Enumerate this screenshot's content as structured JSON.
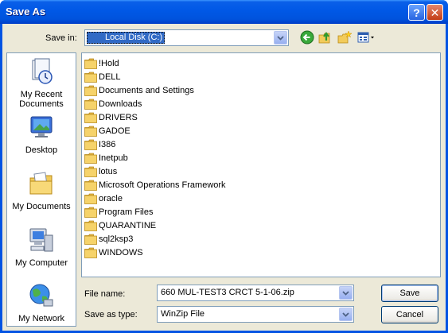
{
  "window": {
    "title": "Save As"
  },
  "toolbar": {
    "save_in_label": "Save in:",
    "save_in_value": "Local Disk (C:)"
  },
  "places": [
    {
      "label": "My Recent\nDocuments",
      "icon": "recent-documents-icon"
    },
    {
      "label": "Desktop",
      "icon": "desktop-icon"
    },
    {
      "label": "My Documents",
      "icon": "my-documents-icon"
    },
    {
      "label": "My Computer",
      "icon": "my-computer-icon"
    },
    {
      "label": "My Network",
      "icon": "my-network-icon"
    }
  ],
  "files": [
    "!Hold",
    "DELL",
    "Documents and Settings",
    "Downloads",
    "DRIVERS",
    "GADOE",
    "I386",
    "Inetpub",
    "lotus",
    "Microsoft Operations Framework",
    "oracle",
    "Program Files",
    "QUARANTINE",
    "sql2ksp3",
    "WINDOWS"
  ],
  "form": {
    "file_name_label": "File name:",
    "file_name_value": "660 MUL-TEST3 CRCT 5-1-06.zip",
    "save_as_type_label": "Save as type:",
    "save_as_type_value": "WinZip File"
  },
  "buttons": {
    "save": "Save",
    "cancel": "Cancel"
  },
  "colors": {
    "titlebar": "#0058e6",
    "dialog_face": "#ece9d8",
    "selection": "#316ac5",
    "folder": "#f6d36a",
    "close_button": "#c33c15"
  }
}
